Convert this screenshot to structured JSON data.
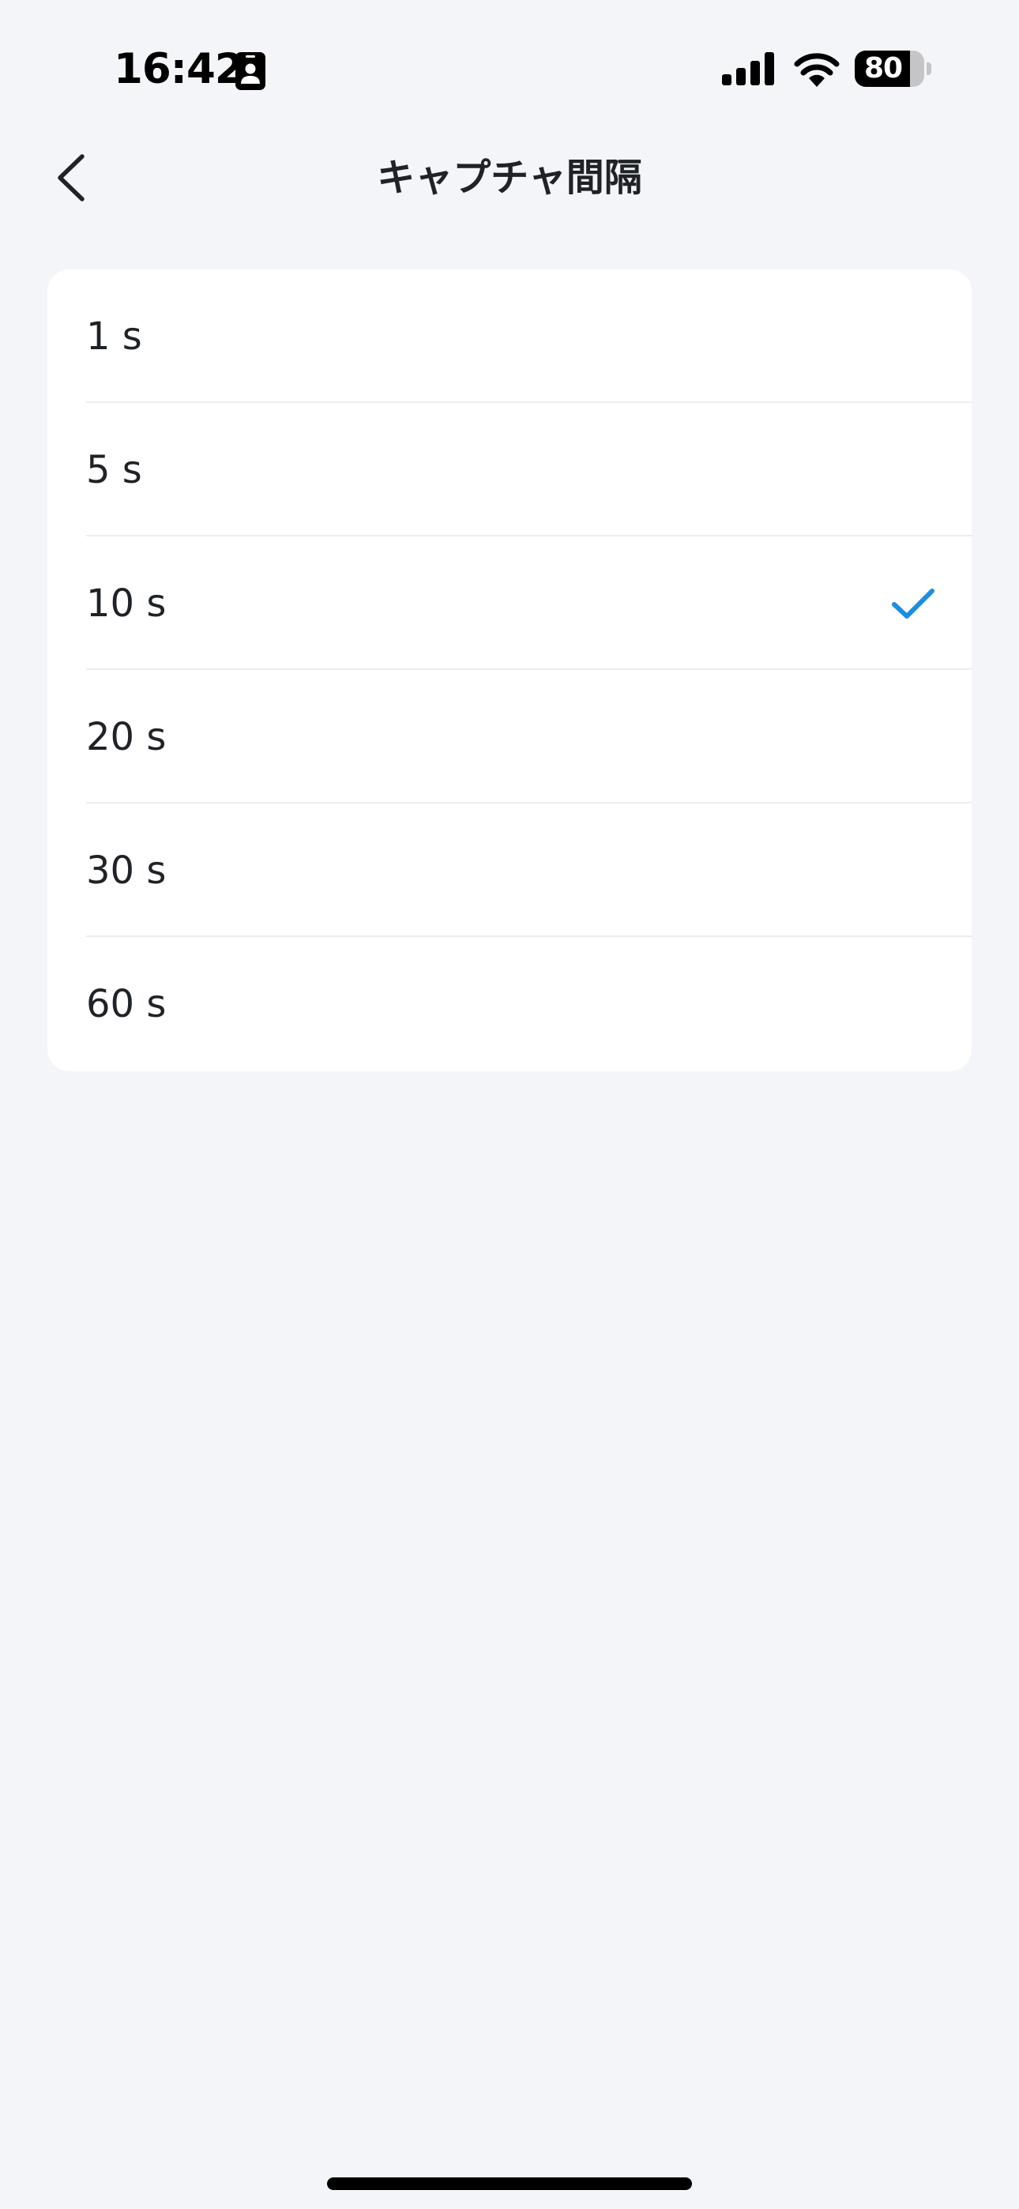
{
  "status_bar": {
    "time": "16:42",
    "battery_level": "80",
    "battery_percent": 80,
    "icons": [
      "focus-contact-icon",
      "cellular-signal-icon",
      "wifi-icon",
      "battery-icon"
    ]
  },
  "nav": {
    "title": "キャプチャ間隔",
    "back_icon": "chevron-left-icon"
  },
  "options": [
    {
      "label": "1 s",
      "selected": false
    },
    {
      "label": "5 s",
      "selected": false
    },
    {
      "label": "10 s",
      "selected": true
    },
    {
      "label": "20 s",
      "selected": false
    },
    {
      "label": "30 s",
      "selected": false
    },
    {
      "label": "60 s",
      "selected": false
    }
  ],
  "colors": {
    "background": "#f4f5f9",
    "card": "#ffffff",
    "text": "#1f2226",
    "accent": "#1a8fe0",
    "divider": "#ececef"
  }
}
